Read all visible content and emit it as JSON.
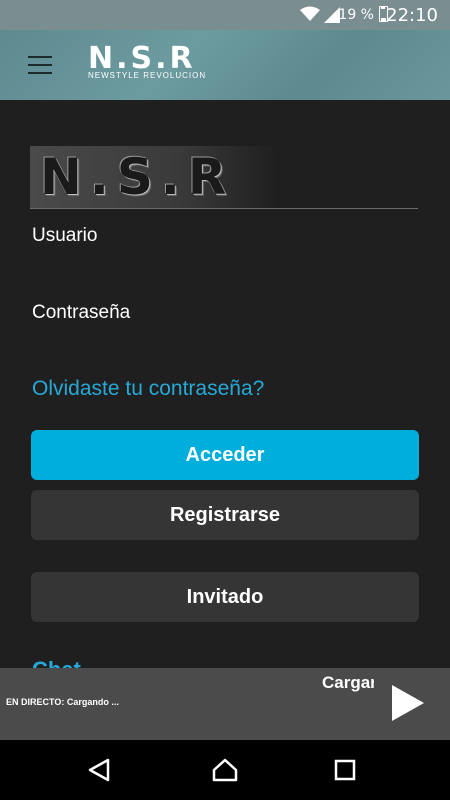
{
  "status_bar": {
    "battery_percent": "19 %",
    "time": "22:10",
    "icons": [
      "wifi-icon",
      "signal-icon",
      "battery-icon"
    ]
  },
  "app_bar": {
    "menu_icon": "hamburger-menu-icon",
    "logo_text": "N.S.R",
    "logo_subtitle": "NEWSTYLE REVOLUCION"
  },
  "login": {
    "hero_logo_text": "N.S.R",
    "username_label": "Usuario",
    "password_label": "Contraseña",
    "forgot_password": "Olvidaste tu contraseña?",
    "login_button": "Acceder",
    "register_button": "Registrarse",
    "guest_button": "Invitado",
    "chat_heading": "Chat"
  },
  "player": {
    "live_text": "EN DIRECTO: Cargando ...",
    "loading_text": "Cargando",
    "play_icon": "play-icon"
  },
  "nav_bar": {
    "icons": [
      "back-icon",
      "home-icon",
      "recents-icon"
    ]
  },
  "colors": {
    "accent": "#00aedb",
    "link": "#28a8d6",
    "background": "#1f1f1f",
    "secondary_button": "#353535"
  }
}
